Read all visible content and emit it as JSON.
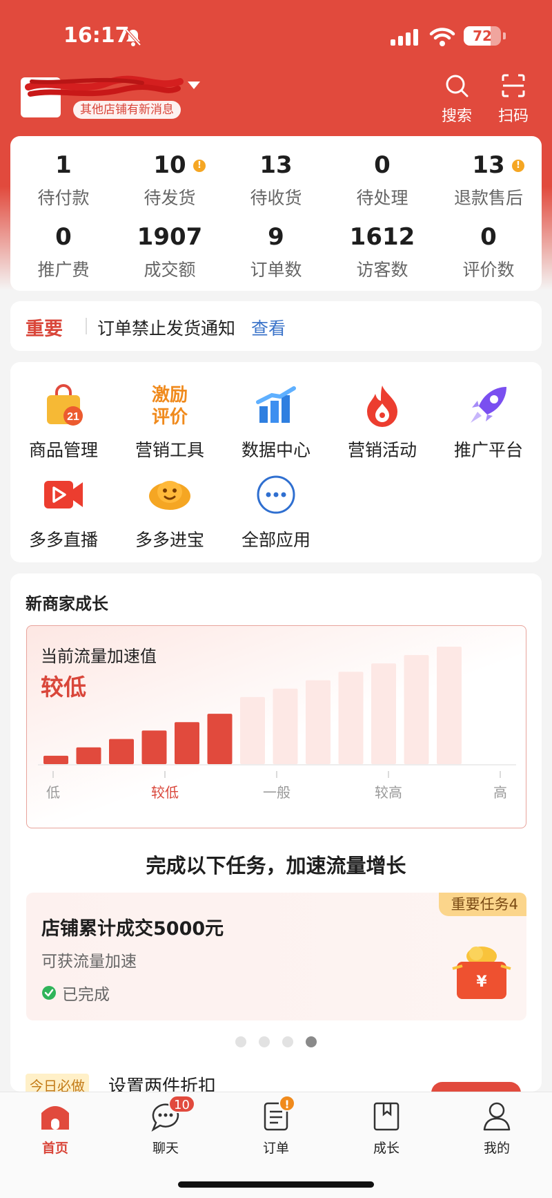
{
  "status_bar": {
    "time": "16:17",
    "battery": "72",
    "battery_level": 0.72
  },
  "header": {
    "store_message": "其他店铺有新消息",
    "search_label": "搜索",
    "scan_label": "扫码"
  },
  "stats": {
    "row1": [
      {
        "value": "1",
        "label": "待付款",
        "alert": false
      },
      {
        "value": "10",
        "label": "待发货",
        "alert": true
      },
      {
        "value": "13",
        "label": "待收货",
        "alert": false
      },
      {
        "value": "0",
        "label": "待处理",
        "alert": false
      },
      {
        "value": "13",
        "label": "退款售后",
        "alert": true
      }
    ],
    "row2": [
      {
        "value": "0",
        "label": "推广费"
      },
      {
        "value": "1907",
        "label": "成交额"
      },
      {
        "value": "9",
        "label": "订单数"
      },
      {
        "value": "1612",
        "label": "访客数"
      },
      {
        "value": "0",
        "label": "评价数"
      }
    ],
    "alert_mark": "!"
  },
  "notice": {
    "tag": "重要",
    "text": "订单禁止发货通知",
    "link": "查看"
  },
  "apps": [
    {
      "label": "商品管理",
      "icon": "shopping-bag-icon",
      "badge": "21"
    },
    {
      "label": "营销工具",
      "icon": "incentive-review-icon",
      "icon_text_1": "激励",
      "icon_text_2": "评价"
    },
    {
      "label": "数据中心",
      "icon": "bar-chart-icon"
    },
    {
      "label": "营销活动",
      "icon": "flame-icon"
    },
    {
      "label": "推广平台",
      "icon": "rocket-icon"
    },
    {
      "label": "多多直播",
      "icon": "video-camera-icon"
    },
    {
      "label": "多多进宝",
      "icon": "gold-ingot-icon"
    },
    {
      "label": "全部应用",
      "icon": "more-dots-icon"
    }
  ],
  "growth": {
    "title": "新商家成长",
    "speed_caption": "当前流量加速值",
    "speed_value": "较低",
    "tasks_title": "完成以下任务，加速流量增长",
    "task": {
      "ribbon": "重要任务4",
      "title": "店铺累计成交5000元",
      "subtitle": "可获流量加速",
      "status": "已完成"
    },
    "pager_count": 4,
    "pager_active": 3
  },
  "chart_data": {
    "type": "bar",
    "title": "当前流量加速值",
    "tick_labels": [
      "低",
      "较低",
      "一般",
      "较高",
      "高"
    ],
    "current_level": "较低",
    "values": [
      1,
      2,
      3,
      4,
      5,
      6,
      8,
      9,
      10,
      11,
      12,
      13,
      14
    ],
    "highlighted_count": 6,
    "colors": {
      "active": "#e14a3d",
      "inactive": "#fde8e5"
    }
  },
  "today": {
    "tag": "今日必做",
    "text": "设置两件折扣"
  },
  "tabbar": [
    {
      "label": "首页",
      "icon": "home-icon",
      "active": true
    },
    {
      "label": "聊天",
      "icon": "chat-bubble-icon",
      "badge": "10"
    },
    {
      "label": "订单",
      "icon": "order-list-icon",
      "badge": "!"
    },
    {
      "label": "成长",
      "icon": "growth-book-icon"
    },
    {
      "label": "我的",
      "icon": "user-profile-icon"
    }
  ],
  "colors": {
    "brand": "#e14a3d",
    "link": "#3a73c9",
    "alert": "#f5a623"
  }
}
